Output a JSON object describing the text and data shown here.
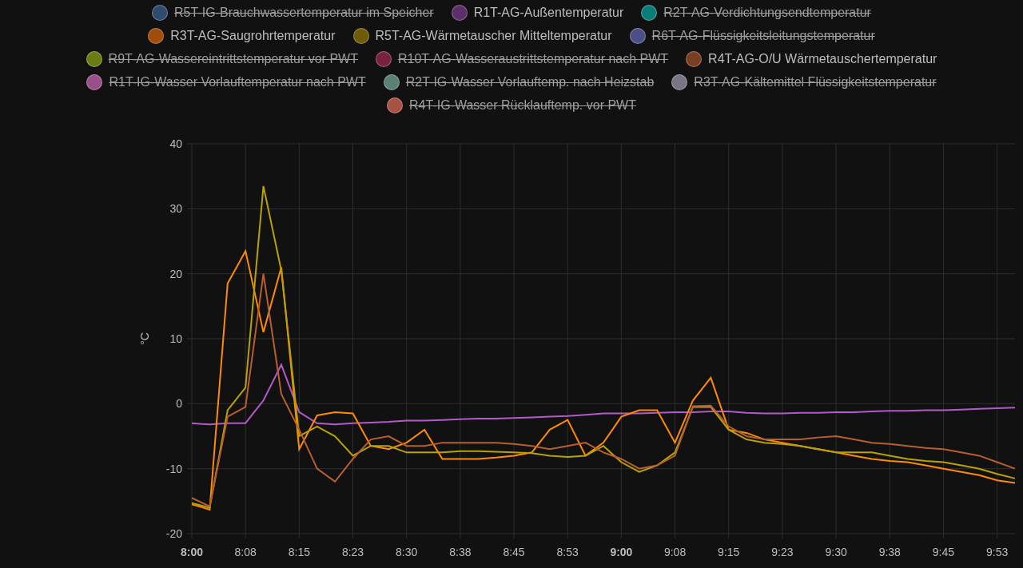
{
  "legend": [
    {
      "label": "R5T-IG-Brauchwassertemperatur im Speicher",
      "color": "#2f4b6e",
      "hidden": true
    },
    {
      "color": "#5c2e6a",
      "hidden": false
    },
    {
      "label": "R2T-AG-Verdichtungsendtemperatur",
      "color": "#0b7d77",
      "hidden": true
    },
    {
      "color": "#a04c0a",
      "hidden": false
    },
    {
      "color": "#6e5b08",
      "hidden": false
    },
    {
      "label": "R6T-AG-Flüssigkeitsleitungstemperatur",
      "color": "#4e4e86",
      "hidden": true
    },
    {
      "label": "R9T-AG-Wassereintrittstemperatur vor PWT",
      "color": "#6b7d10",
      "hidden": true
    },
    {
      "label": "R10T-AG-Wasseraustrittstemperatur nach PWT",
      "color": "#7a2040",
      "hidden": true
    },
    {
      "color": "#7a3f20",
      "hidden": false
    },
    {
      "label": "R1T-IG-Wasser Vorlauftemperatur nach PWT",
      "color": "#9b4f8a",
      "hidden": true
    },
    {
      "label": "R2T-IG-Wasser Vorlauftemp. nach Heizstab",
      "color": "#5a8077",
      "hidden": true
    },
    {
      "label": "R3T-AG-Kältemittel Flüssigkeitstemperatur",
      "color": "#7a7585",
      "hidden": true
    },
    {
      "label": "R4T-IG-Wasser Rücklauftemp. vor PWT",
      "color": "#a85246",
      "hidden": true
    }
  ],
  "chart_data": {
    "type": "line",
    "ylabel": "°C",
    "categories": [
      "8:00",
      null,
      null,
      "8:08",
      null,
      null,
      "8:15",
      null,
      null,
      "8:23",
      null,
      null,
      "8:30",
      null,
      null,
      "8:38",
      null,
      null,
      "8:45",
      null,
      null,
      "8:53",
      null,
      null,
      "9:00",
      null,
      null,
      "9:08",
      null,
      null,
      "9:15",
      null,
      null,
      "9:23",
      null,
      null,
      "9:30",
      null,
      null,
      "9:38",
      null,
      null,
      "9:45",
      null,
      null,
      "9:53",
      null
    ],
    "ylim": [
      -20,
      40
    ],
    "grid": true,
    "yticks": [
      -20,
      -10,
      0,
      10,
      20,
      30,
      40
    ],
    "series": [
      {
        "name": "R1T-AG-Außentemperatur",
        "color": "#b35ac8",
        "values": [
          -3,
          -3.2,
          -3,
          -3,
          0.5,
          6,
          -1.3,
          -3,
          -3.2,
          -3,
          -2.9,
          -2.8,
          -2.6,
          -2.6,
          -2.5,
          -2.4,
          -2.3,
          -2.3,
          -2.2,
          -2.1,
          -2,
          -1.9,
          -1.7,
          -1.5,
          -1.5,
          -1.5,
          -1.4,
          -1.3,
          -1.3,
          -1.2,
          -1.2,
          -1.4,
          -1.5,
          -1.5,
          -1.4,
          -1.4,
          -1.3,
          -1.3,
          -1.2,
          -1.1,
          -1.1,
          -1,
          -1,
          -0.9,
          -0.8,
          -0.7,
          -0.6
        ]
      },
      {
        "name": "R3T-AG-Saugrohrtemperatur",
        "color": "#ff8c00",
        "values": [
          -15.5,
          -16.3,
          18.5,
          23.5,
          11,
          21,
          -7,
          -1.8,
          -1.3,
          -1.5,
          -6.5,
          -7,
          -6,
          -4,
          -8.5,
          -8.5,
          -8.5,
          -8.3,
          -8,
          -7.5,
          -4,
          -2.5,
          -8,
          -6,
          -2,
          -1,
          -1,
          -6,
          0.5,
          4,
          -4,
          -4.5,
          -5.5,
          -6,
          -6.5,
          -7,
          -7.5,
          -8,
          -8.5,
          -8.8,
          -9,
          -9.5,
          -10,
          -10.5,
          -11,
          -11.8,
          -12.2
        ]
      },
      {
        "name": "R5T-AG-Wärmetauscher Mitteltemperatur",
        "color": "#b8a300",
        "values": [
          -15.3,
          -16,
          -1,
          2.5,
          33.5,
          20.5,
          -5,
          -3.5,
          -5,
          -8,
          -6.5,
          -6.5,
          -7.5,
          -7.5,
          -7.5,
          -7.3,
          -7.3,
          -7.4,
          -7.5,
          -7.6,
          -8,
          -8.2,
          -8,
          -6.5,
          -9,
          -10.5,
          -9.5,
          -7.5,
          -0.5,
          -0.5,
          -4,
          -5.5,
          -6,
          -6.2,
          -6.5,
          -7,
          -7.5,
          -7.5,
          -7.5,
          -8,
          -8.5,
          -8.8,
          -9,
          -9.5,
          -10,
          -10.8,
          -11.5
        ]
      },
      {
        "name": "R4T-AG-O/U Wärmetauschertemperatur",
        "color": "#b85f30",
        "values": [
          -14.5,
          -15.8,
          -2,
          -0.5,
          20,
          1.5,
          -4,
          -10,
          -12,
          -8.5,
          -5.5,
          -5,
          -6.5,
          -6.5,
          -6,
          -6,
          -6,
          -6,
          -6.2,
          -6.5,
          -7,
          -6.5,
          -6,
          -7.5,
          -8.5,
          -10,
          -9.5,
          -8,
          -0.4,
          -0.3,
          -3.5,
          -5,
          -5.5,
          -5.5,
          -5.5,
          -5.2,
          -5,
          -5.5,
          -6,
          -6.2,
          -6.5,
          -6.8,
          -7,
          -7.5,
          -8,
          -9,
          -10
        ]
      }
    ]
  }
}
